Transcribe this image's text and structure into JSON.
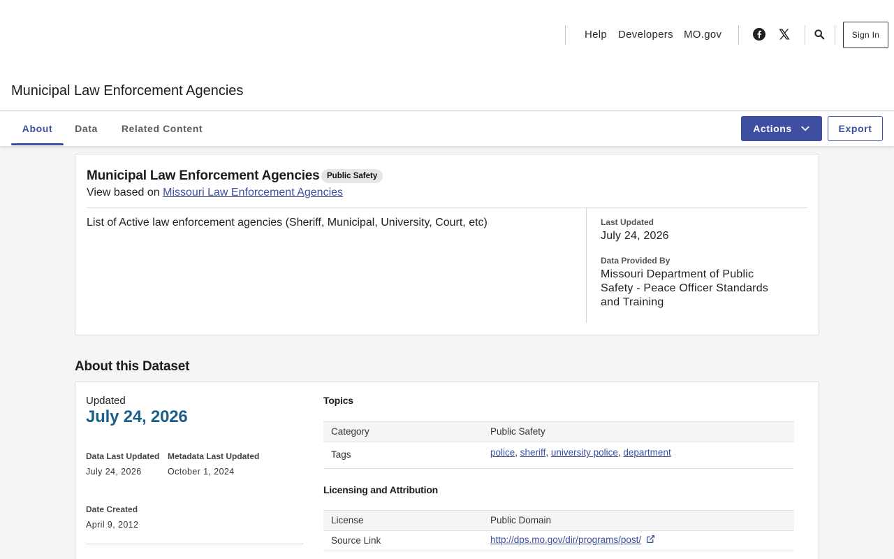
{
  "header": {
    "nav": [
      "Help",
      "Developers",
      "MO.gov"
    ],
    "social_icons": [
      "facebook-icon",
      "x-twitter-icon"
    ],
    "search_icon": "search-icon",
    "signin_label": "Sign In"
  },
  "page": {
    "title": "Municipal Law Enforcement Agencies"
  },
  "tabs": [
    {
      "label": "About",
      "active": true
    },
    {
      "label": "Data",
      "active": false
    },
    {
      "label": "Related Content",
      "active": false
    }
  ],
  "toolbar": {
    "actions_label": "Actions",
    "export_label": "Export"
  },
  "summary": {
    "title": "Municipal Law Enforcement Agencies",
    "category_pill": "Public Safety",
    "view_based_prefix": "View based on",
    "view_based_link": "Missouri Law Enforcement Agencies",
    "description": "List of Active law enforcement agencies (Sheriff, Municipal, University, Court, etc)",
    "last_updated_label": "Last Updated",
    "last_updated_value": "July 24, 2026",
    "provided_by_label": "Data Provided By",
    "provided_by_value": "Missouri Department of Public Safety - Peace Officer Standards and Training"
  },
  "about": {
    "section_title": "About this Dataset",
    "updated_label": "Updated",
    "updated_value": "July 24, 2026",
    "data_last_updated_label": "Data Last Updated",
    "data_last_updated_value": "July 24, 2026",
    "metadata_last_updated_label": "Metadata Last Updated",
    "metadata_last_updated_value": "October 1, 2024",
    "date_created_label": "Date Created",
    "date_created_value": "April 9, 2012",
    "topics_title": "Topics",
    "category_key": "Category",
    "category_value": "Public Safety",
    "tags_key": "Tags",
    "tags": [
      "police",
      "sheriff",
      "university police",
      "department"
    ],
    "licensing_title": "Licensing and Attribution",
    "license_key": "License",
    "license_value": "Public Domain",
    "source_link_key": "Source Link",
    "source_link_value": "http://dps.mo.gov/dir/programs/post/"
  },
  "colors": {
    "accent": "#3e4ea0",
    "date_accent": "#1d5f8a"
  }
}
